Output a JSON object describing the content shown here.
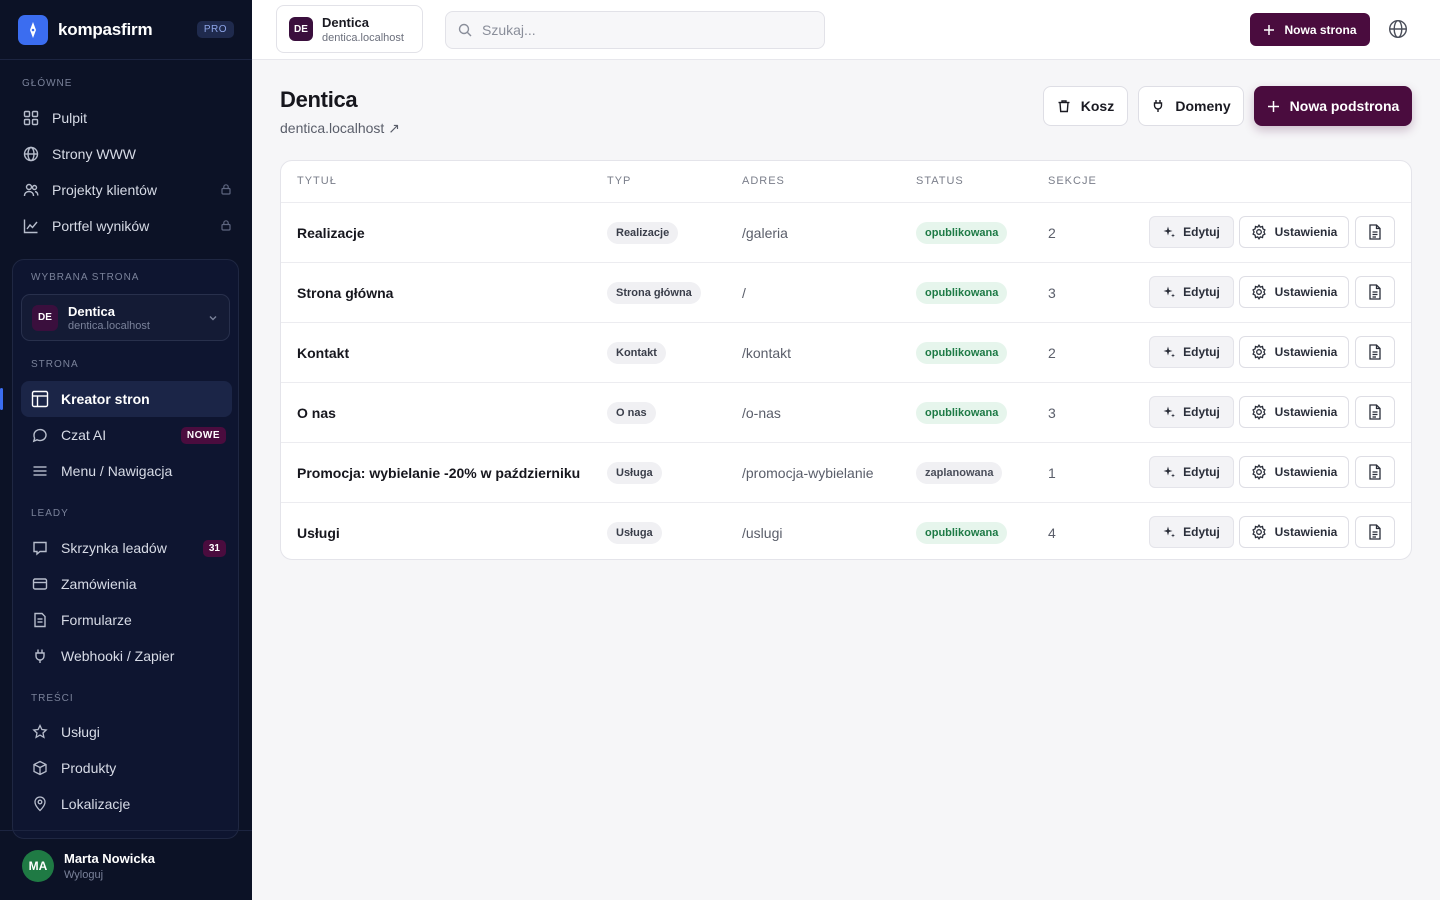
{
  "app": {
    "name": "kompasfirm",
    "badge": "PRO"
  },
  "sidebar": {
    "section_main": "Główne",
    "main_items": [
      {
        "label": "Pulpit",
        "icon": "grid-icon",
        "locked": false
      },
      {
        "label": "Strony WWW",
        "icon": "globe-icon",
        "locked": false
      },
      {
        "label": "Projekty klientów",
        "icon": "users-icon",
        "locked": true
      },
      {
        "label": "Portfel wyników",
        "icon": "chart-icon",
        "locked": true
      }
    ],
    "selected_site_heading": "Wybrana strona",
    "selected_site": {
      "initials": "DE",
      "name": "Dentica",
      "domain": "dentica.localhost"
    },
    "section_site": "Strona",
    "site_items": [
      {
        "label": "Kreator stron",
        "icon": "layout-icon",
        "active": true
      },
      {
        "label": "Czat AI",
        "icon": "chat-icon",
        "badge": "NOWE"
      },
      {
        "label": "Menu / Nawigacja",
        "icon": "menu-icon"
      }
    ],
    "section_leads": "Leady",
    "lead_items": [
      {
        "label": "Skrzynka leadów",
        "icon": "inbox-icon",
        "count": "31"
      },
      {
        "label": "Zamówienia",
        "icon": "card-icon"
      },
      {
        "label": "Formularze",
        "icon": "form-icon"
      },
      {
        "label": "Webhooki / Zapier",
        "icon": "plug-icon"
      }
    ],
    "section_content": "Treści",
    "content_items": [
      {
        "label": "Usługi",
        "icon": "star-icon"
      },
      {
        "label": "Produkty",
        "icon": "box-icon"
      },
      {
        "label": "Lokalizacje",
        "icon": "pin-icon"
      }
    ],
    "user": {
      "initials": "MA",
      "name": "Marta Nowicka",
      "logout": "Wyloguj"
    }
  },
  "topbar": {
    "site": {
      "initials": "DE",
      "name": "Dentica",
      "domain": "dentica.localhost"
    },
    "search_placeholder": "Szukaj...",
    "new_page_label": "Nowa strona"
  },
  "page": {
    "title": "Dentica",
    "subtitle": "dentica.localhost ↗",
    "trash_label": "Kosz",
    "domains_label": "Domeny",
    "new_subpage_label": "Nowa podstrona"
  },
  "table": {
    "headers": {
      "title": "Tytuł",
      "type": "Typ",
      "address": "Adres",
      "status": "Status",
      "sections": "Sekcje"
    },
    "edit_label": "Edytuj",
    "settings_label": "Ustawienia",
    "rows": [
      {
        "title": "Realizacje",
        "type": "Realizacje",
        "address": "/galeria",
        "status": "opublikowana",
        "status_kind": "published",
        "sections": "2"
      },
      {
        "title": "Strona główna",
        "type": "Strona główna",
        "address": "/",
        "status": "opublikowana",
        "status_kind": "published",
        "sections": "3"
      },
      {
        "title": "Kontakt",
        "type": "Kontakt",
        "address": "/kontakt",
        "status": "opublikowana",
        "status_kind": "published",
        "sections": "2"
      },
      {
        "title": "O nas",
        "type": "O nas",
        "address": "/o-nas",
        "status": "opublikowana",
        "status_kind": "published",
        "sections": "3"
      },
      {
        "title": "Promocja: wybielanie -20% w październiku",
        "type": "Usługa",
        "address": "/promocja-wybielanie",
        "status": "zaplanowana",
        "status_kind": "scheduled",
        "sections": "1"
      },
      {
        "title": "Usługi",
        "type": "Usługa",
        "address": "/uslugi",
        "status": "opublikowana",
        "status_kind": "published",
        "sections": "4"
      }
    ]
  },
  "colors": {
    "sidebar_bg": "#0c1226",
    "brand_blue": "#3b6df0",
    "primary": "#4a0c3e",
    "published_text": "#1d7a45",
    "published_bg": "#e6f5ec"
  }
}
